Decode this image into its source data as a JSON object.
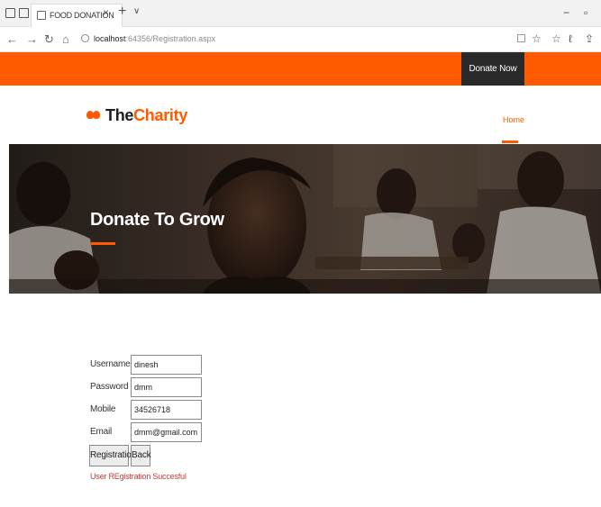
{
  "browser": {
    "tab_title": "FOOD DONATION",
    "tab_close": "×",
    "new_tab": "+",
    "tab_dropdown": "∨",
    "minimize": "−",
    "maximize": "▫",
    "url_host": "localhost",
    "url_path": ":64356/Registration.aspx",
    "back": "←",
    "forward": "→",
    "refresh": "↻",
    "home": "⌂",
    "icons": [
      "tab-preview-icon",
      "tab-aside-icon",
      "reading-view-icon",
      "favorite-star-icon",
      "favorites-bar-icon",
      "pen-icon",
      "share-icon"
    ]
  },
  "site": {
    "donate_now": "Donate Now",
    "logo_the": "The",
    "logo_charity": "Charity",
    "nav_home": "Home",
    "hero_title": "Donate To Grow",
    "accent_color": "#ff5a00"
  },
  "form": {
    "fields": [
      {
        "label": "Username",
        "value": "dinesh"
      },
      {
        "label": "Password",
        "value": "dmm"
      },
      {
        "label": "Mobile",
        "value": "34526718"
      },
      {
        "label": "Email",
        "value": "dmm@gmail.com"
      }
    ],
    "register_label": "Registration",
    "back_label": "Back",
    "status_message": "User REgistration Succesful"
  }
}
